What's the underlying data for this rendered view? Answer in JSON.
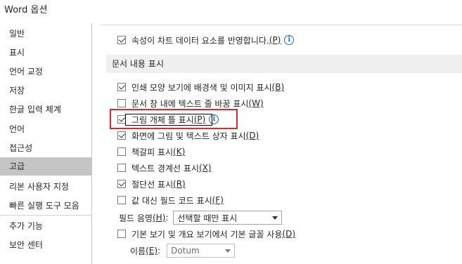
{
  "window": {
    "title": "Word 옵션"
  },
  "sidebar": {
    "items": [
      {
        "label": "일반"
      },
      {
        "label": "표시"
      },
      {
        "label": "언어 교정"
      },
      {
        "label": "저장"
      },
      {
        "label": "한글 입력 체계"
      },
      {
        "label": "언어"
      },
      {
        "label": "접근성"
      },
      {
        "label": "고급",
        "selected": true
      },
      {
        "label": "리본 사용자 지정"
      },
      {
        "label": "빠른 실행 도구 모음"
      },
      {
        "label": "추가 기능"
      },
      {
        "label": "보안 센터"
      }
    ]
  },
  "content": {
    "chart_attr_option": {
      "label": "속성이 차트 데이터 요소를 반영합니다.",
      "key": "(P)",
      "checked": true
    },
    "section_title": "문서 내용 표시",
    "options": [
      {
        "label": "인쇄 모양 보기에 배경색 및 이미지 표시",
        "key": "(B)",
        "checked": true
      },
      {
        "label": "문서 창 내에 텍스트 줄 바꿈 표시",
        "key": "(W)",
        "checked": false
      },
      {
        "label": "그림 개체 틀 표시",
        "key": "(P)",
        "checked": true,
        "info": true
      },
      {
        "label": "화면에 그림 및 텍스트 상자 표시",
        "key": "(D)",
        "checked": true
      },
      {
        "label": "책갈피 표시",
        "key": "(K)",
        "checked": false
      },
      {
        "label": "텍스트 경계선 표시",
        "key": "(X)",
        "checked": false
      },
      {
        "label": "절단선 표시",
        "key": "(R)",
        "checked": true
      },
      {
        "label": "값 대신 필드 코드 표시",
        "key": "(F)",
        "checked": false
      }
    ],
    "field_shading": {
      "label": "필드 음영",
      "key": "(H)",
      "colon": ":",
      "value": "선택할 때만 표시"
    },
    "draft_font": {
      "label": "기본 보기 및 개요 보기에서 기본 글꼴 사용",
      "key": "(D)",
      "checked": false
    },
    "name_field": {
      "label": "이름",
      "key": "(E)",
      "colon": ":",
      "value": "Dotum"
    }
  },
  "colors": {
    "highlight": "#e0272e",
    "selected_bg": "#c5c5c5",
    "info_icon": "#1e6fc4"
  }
}
